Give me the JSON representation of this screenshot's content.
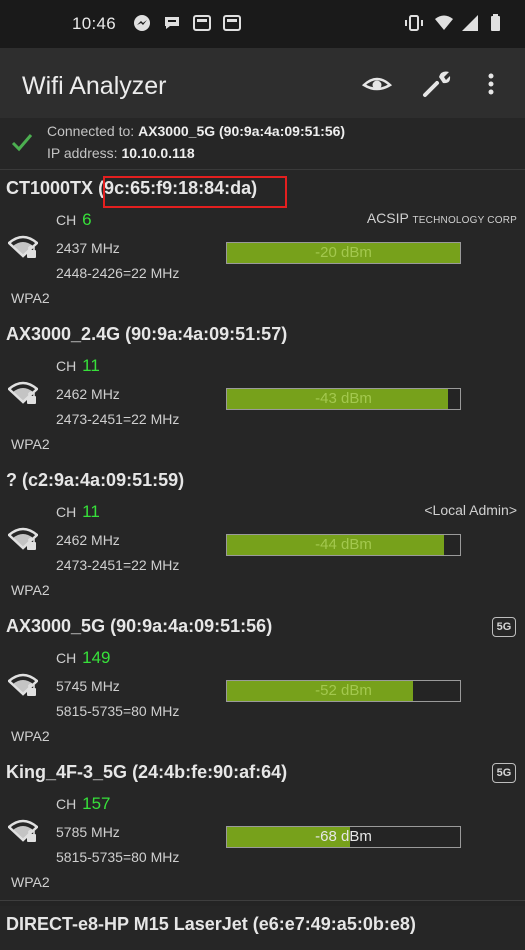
{
  "status_bar": {
    "time": "10:46",
    "icons": [
      "messenger-icon",
      "chat-bubble-icon",
      "news-icon",
      "news-icon",
      "vibrate-icon",
      "wifi-icon",
      "signal-icon",
      "battery-icon"
    ]
  },
  "app_bar": {
    "title": "Wifi Analyzer",
    "actions": [
      "eye-icon",
      "wrench-icon",
      "more-vert-icon"
    ]
  },
  "connection": {
    "connected_label": "Connected to:",
    "connected_value": "AX3000_5G (90:9a:4a:09:51:56)",
    "ip_label": "IP address:",
    "ip_value": "10.10.0.118"
  },
  "networks": [
    {
      "ssid": "CT1000TX",
      "mac": "(9c:65:f9:18:84:da)",
      "ch_label": "CH",
      "channel": "6",
      "frequency": "2437 MHz",
      "range": "2448-2426=22 MHz",
      "security": "WPA2",
      "vendor_main": "ACSIP",
      "vendor_small": "TECHNOLOGY CORP",
      "signal": "-20 dBm",
      "signal_fill": 1.0,
      "band_badge": ""
    },
    {
      "ssid": "AX3000_2.4G",
      "mac": "(90:9a:4a:09:51:57)",
      "ch_label": "CH",
      "channel": "11",
      "frequency": "2462 MHz",
      "range": "2473-2451=22 MHz",
      "security": "WPA2",
      "vendor_main": "",
      "vendor_small": "",
      "signal": "-43 dBm",
      "signal_fill": 0.95,
      "band_badge": ""
    },
    {
      "ssid": "?",
      "mac": "(c2:9a:4a:09:51:59)",
      "ch_label": "CH",
      "channel": "11",
      "frequency": "2462 MHz",
      "range": "2473-2451=22 MHz",
      "security": "WPA2",
      "vendor_main": "<Local Admin>",
      "vendor_small": "",
      "signal": "-44 dBm",
      "signal_fill": 0.93,
      "band_badge": ""
    },
    {
      "ssid": "AX3000_5G",
      "mac": "(90:9a:4a:09:51:56)",
      "ch_label": "CH",
      "channel": "149",
      "frequency": "5745 MHz",
      "range": "5815-5735=80 MHz",
      "security": "WPA2",
      "vendor_main": "",
      "vendor_small": "",
      "signal": "-52 dBm",
      "signal_fill": 0.8,
      "band_badge": "5G"
    },
    {
      "ssid": "King_4F-3_5G",
      "mac": "(24:4b:fe:90:af:64)",
      "ch_label": "CH",
      "channel": "157",
      "frequency": "5785 MHz",
      "range": "5815-5735=80 MHz",
      "security": "WPA2",
      "vendor_main": "",
      "vendor_small": "",
      "signal": "-68 dBm",
      "signal_fill": 0.53,
      "band_badge": "5G"
    }
  ],
  "partial_network": {
    "ssid": "DIRECT-e8-HP M15 LaserJet (e6:e7:49:a5:0b:e8)"
  },
  "colors": {
    "background": "#262626",
    "channel_green": "#37e03a",
    "signal_bar": "#77a11b",
    "highlight_red": "#e31f1f",
    "check_green": "#4caf50"
  }
}
